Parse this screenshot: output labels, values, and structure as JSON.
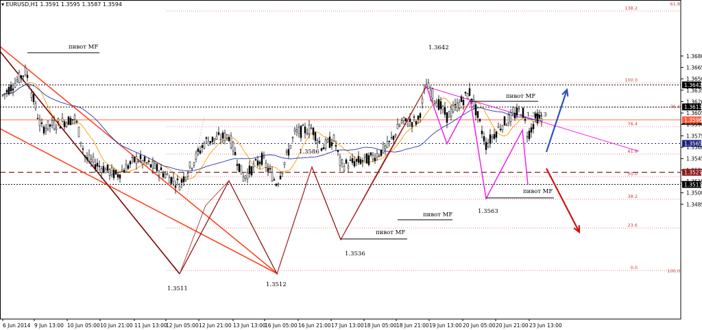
{
  "header": {
    "symbol_line": "EURUSD,H1  1.3591 1.3595 1.3587 1.3594",
    "collapse_icon": "triangle-down-icon"
  },
  "chart_data": {
    "type": "candlestick",
    "symbol": "EURUSD",
    "timeframe": "H1",
    "ohlc_last": {
      "open": 1.3591,
      "high": 1.3595,
      "low": 1.3587,
      "close": 1.3594
    },
    "y_ticks": [
      "1.3680",
      "1.3665",
      "1.3650",
      "1.3635",
      "1.3620",
      "1.3605",
      "1.3590",
      "1.3575",
      "1.3560",
      "1.3545",
      "1.3530",
      "1.3515",
      "1.3500",
      "1.3485"
    ],
    "x_ticks": [
      "6 Jun 2014",
      "9 Jun 13:00",
      "10 Jun 05:00",
      "10 Jun 21:00",
      "11 Jun 13:00",
      "12 Jun 05:00",
      "12 Jun 21:00",
      "13 Jun 13:00",
      "16 Jun 05:00",
      "16 Jun 21:00",
      "17 Jun 13:00",
      "18 Jun 05:00",
      "18 Jun 21:00",
      "19 Jun 13:00",
      "20 Jun 05:00",
      "20 Jun 21:00",
      "23 Jun 13:00"
    ],
    "price_labels": [
      {
        "text": "1.3642",
        "value": 1.3642,
        "color": "#000000"
      },
      {
        "text": "1.3613",
        "value": 1.3613,
        "color": "#000000"
      },
      {
        "text": "1.3594",
        "value": 1.3594,
        "color": "#000000"
      },
      {
        "text": "1.3596",
        "value": 1.3596,
        "color": "#ff5a3c"
      },
      {
        "text": "1.3565",
        "value": 1.3565,
        "color": "#1a237e"
      },
      {
        "text": "1.3527",
        "value": 1.3527,
        "color": "#8b1a1a"
      },
      {
        "text": "1.3511",
        "value": 1.3511,
        "color": "#000000"
      }
    ],
    "annotations": [
      "1.3642",
      "1.3613",
      "1.3586",
      "1.3563",
      "1.3536",
      "1.3511",
      "1.3512"
    ],
    "pivot_label": "пивот MF",
    "fib_levels": [
      "138.2",
      "100.0",
      "76.4",
      "61.8",
      "50.0",
      "38.2",
      "23.6",
      "0.0"
    ],
    "fib_extra": [
      "61.8",
      "76.4",
      "100.0"
    ],
    "colors": {
      "up_arrow": "#2e4fc4",
      "down_arrow": "#d01010",
      "zigzag": "#8b0000",
      "magenta": "#ee22ee",
      "trend": "#ff4422",
      "ma_blue": "#2233aa",
      "ma_orange": "#ff9900"
    }
  }
}
